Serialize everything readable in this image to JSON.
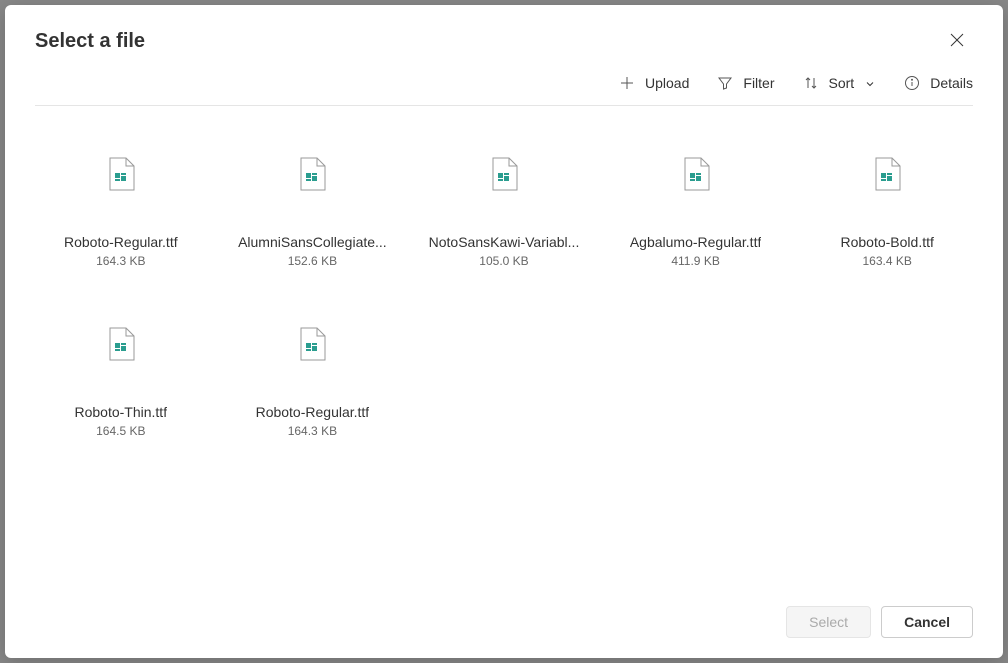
{
  "header": {
    "title": "Select a file"
  },
  "toolbar": {
    "upload": "Upload",
    "filter": "Filter",
    "sort": "Sort",
    "details": "Details"
  },
  "files": [
    {
      "name": "Roboto-Regular.ttf",
      "size": "164.3 KB"
    },
    {
      "name": "AlumniSansCollegiate...",
      "size": "152.6 KB"
    },
    {
      "name": "NotoSansKawi-Variabl...",
      "size": "105.0 KB"
    },
    {
      "name": "Agbalumo-Regular.ttf",
      "size": "411.9 KB"
    },
    {
      "name": "Roboto-Bold.ttf",
      "size": "163.4 KB"
    },
    {
      "name": "Roboto-Thin.ttf",
      "size": "164.5 KB"
    },
    {
      "name": "Roboto-Regular.ttf",
      "size": "164.3 KB"
    }
  ],
  "footer": {
    "select": "Select",
    "cancel": "Cancel"
  }
}
